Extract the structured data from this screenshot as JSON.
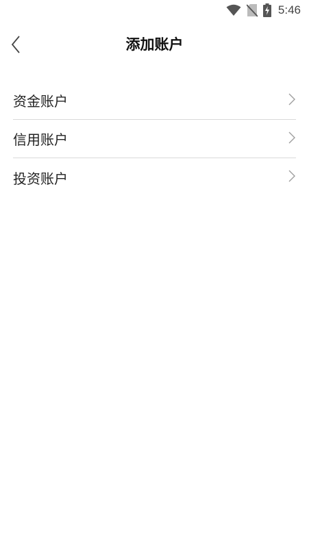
{
  "status_bar": {
    "time": "5:46",
    "icons": [
      "wifi-icon",
      "no-sim-icon",
      "battery-charging-icon"
    ]
  },
  "header": {
    "title": "添加账户",
    "back_icon": "chevron-left-icon"
  },
  "account_types": [
    {
      "label": "资金账户",
      "icon": "chevron-right-icon"
    },
    {
      "label": "信用账户",
      "icon": "chevron-right-icon"
    },
    {
      "label": "投资账户",
      "icon": "chevron-right-icon"
    }
  ],
  "colors": {
    "background": "#ffffff",
    "text": "#222222",
    "divider": "#d9d9d9",
    "chevron": "#9e9e9e"
  }
}
